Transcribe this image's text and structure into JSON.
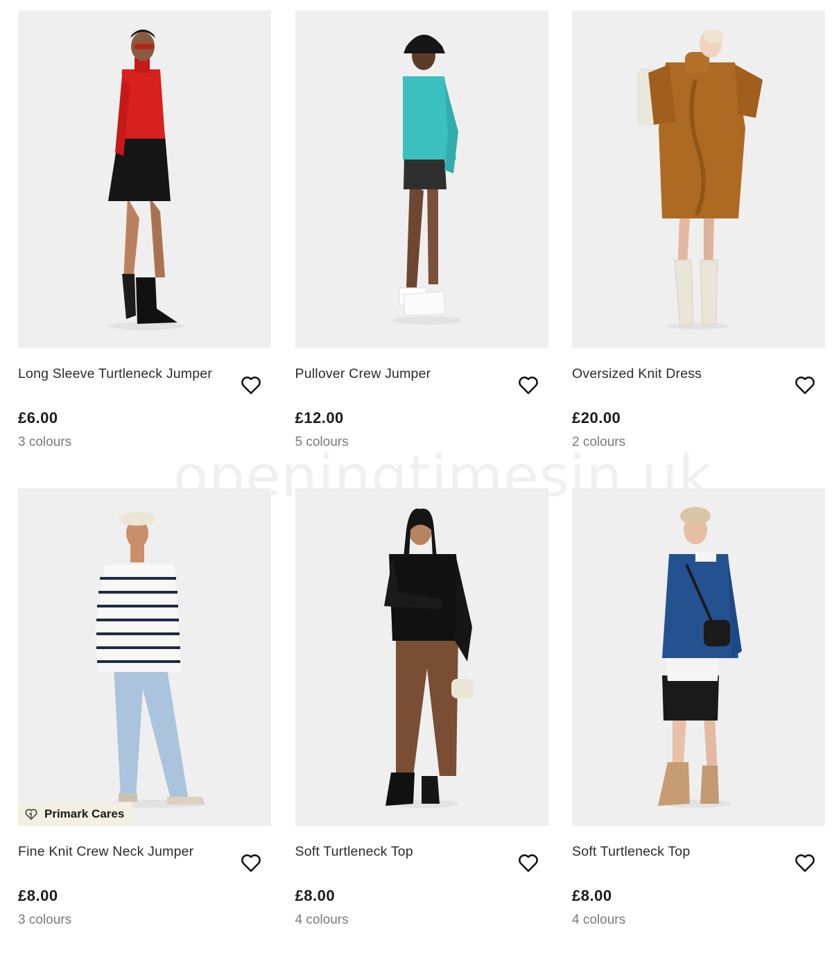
{
  "watermark": "openingtimesin.uk",
  "products": [
    {
      "name": "Long Sleeve Turtleneck Jumper",
      "price": "£6.00",
      "colours": "3 colours",
      "badge": "",
      "image": "model in red turtleneck and black pleated skirt with black boots"
    },
    {
      "name": "Pullover Crew Jumper",
      "price": "£12.00",
      "colours": "5 colours",
      "badge": "",
      "image": "model in turquoise jumper, black bucket hat and grey shorts"
    },
    {
      "name": "Oversized Knit Dress",
      "price": "£20.00",
      "colours": "2 colours",
      "badge": "",
      "image": "model in mustard cable knit dress with cream boots"
    },
    {
      "name": "Fine Knit Crew Neck Jumper",
      "price": "£8.00",
      "colours": "3 colours",
      "badge": "Primark Cares",
      "image": "model in striped jumper and light blue jeans"
    },
    {
      "name": "Soft Turtleneck Top",
      "price": "£8.00",
      "colours": "4 colours",
      "badge": "",
      "image": "model in black top and brown trousers"
    },
    {
      "name": "Soft Turtleneck Top",
      "price": "£8.00",
      "colours": "4 colours",
      "badge": "",
      "image": "model in blue jumper, black skirt and tan boots"
    }
  ],
  "icons": {
    "favourite": "heart-outline-icon",
    "badge": "heart-leaf-icon"
  },
  "colors": {
    "image_bg": "#efefef",
    "badge_bg": "#f3efe2",
    "text": "#2b2b2b",
    "muted": "#7a7a7a"
  }
}
